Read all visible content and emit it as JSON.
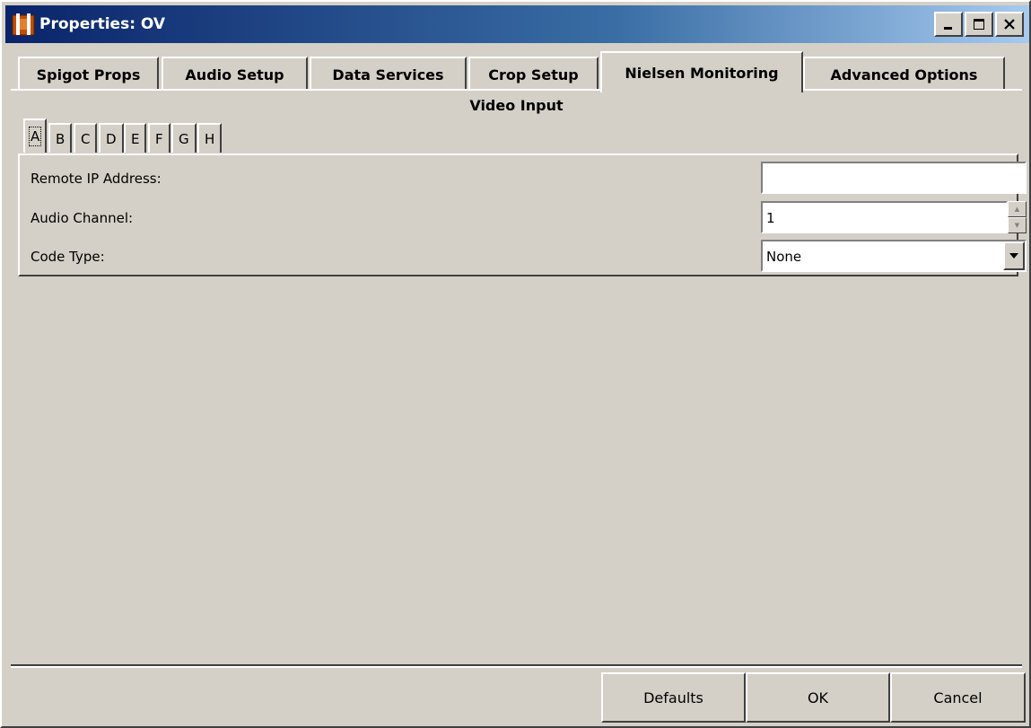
{
  "window": {
    "title": "Properties: OV",
    "controls": [
      "minimize-icon",
      "maximize-icon",
      "close-icon"
    ]
  },
  "tabs": [
    {
      "label": "Spigot Props",
      "active": false
    },
    {
      "label": "Audio Setup",
      "active": false
    },
    {
      "label": "Data Services",
      "active": false
    },
    {
      "label": "Crop Setup",
      "active": false
    },
    {
      "label": "Nielsen Monitoring",
      "active": true
    },
    {
      "label": "Advanced Options",
      "active": false
    }
  ],
  "section": {
    "title": "Video Input"
  },
  "subtabs": [
    {
      "label": "A",
      "active": true
    },
    {
      "label": "B",
      "active": false
    },
    {
      "label": "C",
      "active": false
    },
    {
      "label": "D",
      "active": false
    },
    {
      "label": "E",
      "active": false
    },
    {
      "label": "F",
      "active": false
    },
    {
      "label": "G",
      "active": false
    },
    {
      "label": "H",
      "active": false
    }
  ],
  "fields": {
    "remote_ip": {
      "label": "Remote IP Address:",
      "value": ""
    },
    "audio_channel": {
      "label": "Audio Channel:",
      "value": "1"
    },
    "code_type": {
      "label": "Code Type:",
      "value": "None"
    }
  },
  "buttons": {
    "defaults": "Defaults",
    "ok": "OK",
    "cancel": "Cancel"
  }
}
